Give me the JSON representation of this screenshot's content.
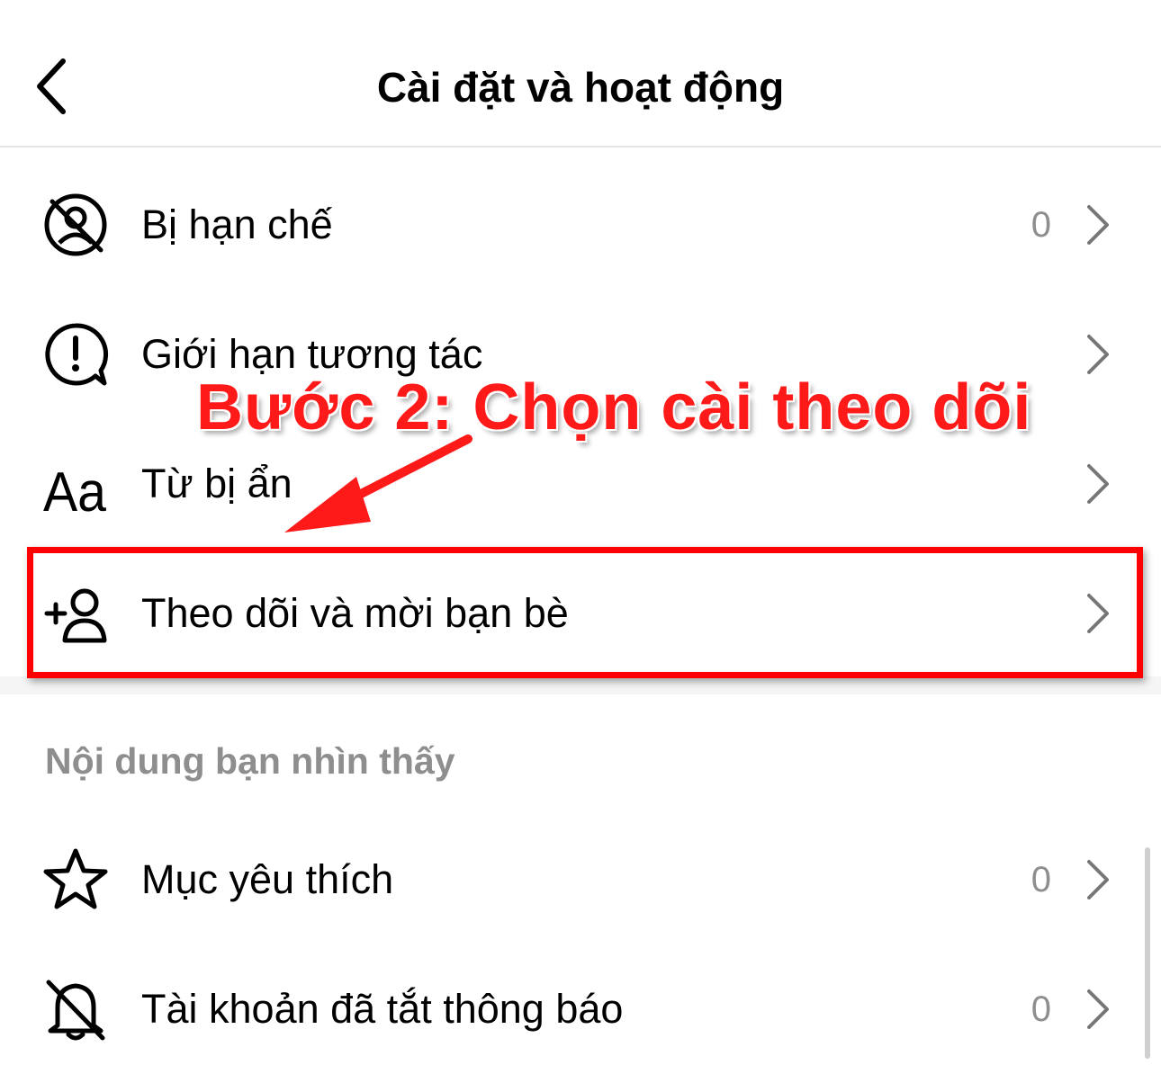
{
  "header": {
    "title": "Cài đặt và hoạt động",
    "back_icon": "chevron-left-icon"
  },
  "rows": [
    {
      "label": "Bị hạn chế",
      "count": "0",
      "icon": "restricted-icon"
    },
    {
      "label": "Giới hạn tương tác",
      "icon": "limit-interactions-icon"
    },
    {
      "label": "Từ bị ẩn",
      "icon": "hidden-words-icon"
    },
    {
      "label": "Theo dõi và mời bạn bè",
      "icon": "add-person-icon"
    }
  ],
  "section": {
    "title": "Nội dung bạn nhìn thấy",
    "rows": [
      {
        "label": "Mục yêu thích",
        "count": "0",
        "icon": "star-icon"
      },
      {
        "label": "Tài khoản đã tắt thông báo",
        "count": "0",
        "icon": "muted-bell-icon"
      }
    ]
  },
  "annotation": {
    "text": "Bước 2: Chọn cài theo dõi",
    "color": "#ff0000"
  }
}
